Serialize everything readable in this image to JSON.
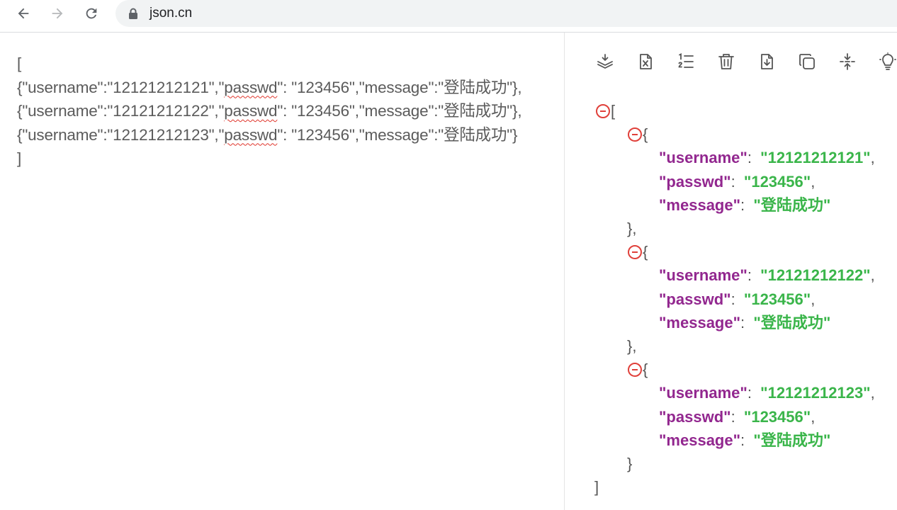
{
  "browser": {
    "url": "json.cn",
    "icons": [
      "back-arrow-icon",
      "forward-arrow-icon",
      "reload-icon",
      "lock-icon"
    ]
  },
  "left": {
    "bracket_open": "[",
    "bracket_close": "]",
    "rows": [
      {
        "pre": "{\"username\":\"12121212121\",\"",
        "spell": "passwd",
        "post": "\": \"123456\",\"message\":\"登陆成功\"},"
      },
      {
        "pre": "{\"username\":\"12121212122\",\"",
        "spell": "passwd",
        "post": "\": \"123456\",\"message\":\"登陆成功\"},"
      },
      {
        "pre": "{\"username\":\"12121212123\",\"",
        "spell": "passwd",
        "post": "\": \"123456\",\"message\":\"登陆成功\"}"
      }
    ]
  },
  "right": {
    "tool_icons": [
      "layers-download-icon",
      "excel-file-icon",
      "ordered-list-icon",
      "trash-icon",
      "file-download-icon",
      "copy-icon",
      "collapse-icon",
      "lightbulb-icon"
    ],
    "records": [
      {
        "username": "12121212121",
        "passwd": "123456",
        "message": "登陆成功"
      },
      {
        "username": "12121212122",
        "passwd": "123456",
        "message": "登陆成功"
      },
      {
        "username": "12121212123",
        "passwd": "123456",
        "message": "登陆成功"
      }
    ],
    "keys": {
      "username": "\"username\"",
      "passwd": "\"passwd\"",
      "message": "\"message\""
    }
  },
  "colors": {
    "key": "#92278f",
    "string": "#3ab54a",
    "collapse_toggle": "#e0403a",
    "raw_text": "#5b5b5b"
  }
}
